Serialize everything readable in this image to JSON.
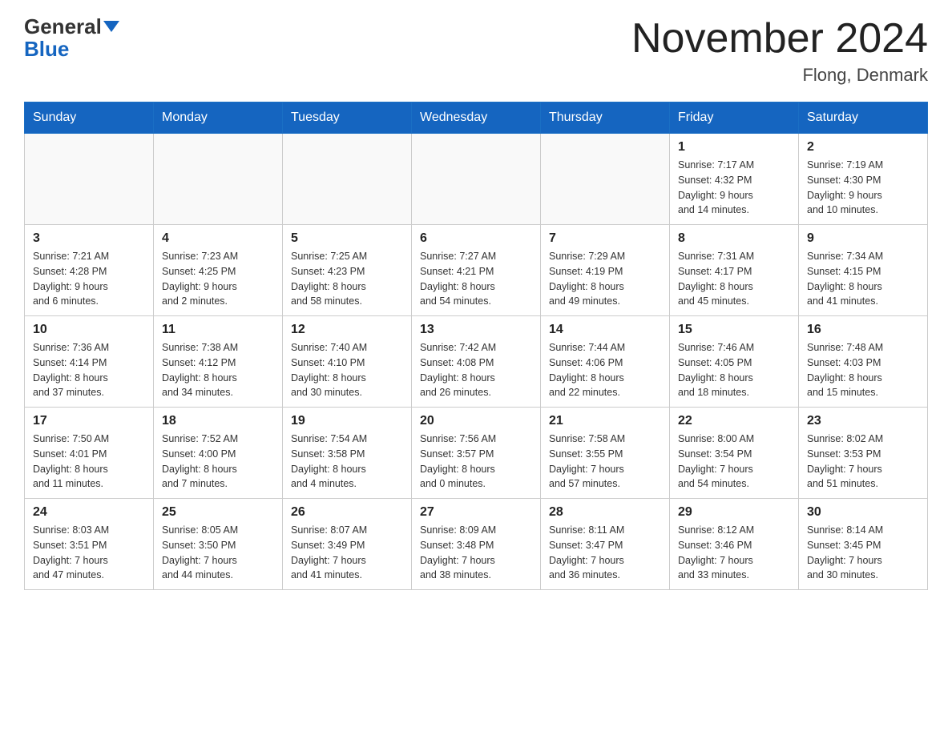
{
  "header": {
    "logo_main": "General",
    "logo_sub": "Blue",
    "title": "November 2024",
    "location": "Flong, Denmark"
  },
  "days_of_week": [
    "Sunday",
    "Monday",
    "Tuesday",
    "Wednesday",
    "Thursday",
    "Friday",
    "Saturday"
  ],
  "weeks": [
    [
      {
        "day": "",
        "info": ""
      },
      {
        "day": "",
        "info": ""
      },
      {
        "day": "",
        "info": ""
      },
      {
        "day": "",
        "info": ""
      },
      {
        "day": "",
        "info": ""
      },
      {
        "day": "1",
        "info": "Sunrise: 7:17 AM\nSunset: 4:32 PM\nDaylight: 9 hours\nand 14 minutes."
      },
      {
        "day": "2",
        "info": "Sunrise: 7:19 AM\nSunset: 4:30 PM\nDaylight: 9 hours\nand 10 minutes."
      }
    ],
    [
      {
        "day": "3",
        "info": "Sunrise: 7:21 AM\nSunset: 4:28 PM\nDaylight: 9 hours\nand 6 minutes."
      },
      {
        "day": "4",
        "info": "Sunrise: 7:23 AM\nSunset: 4:25 PM\nDaylight: 9 hours\nand 2 minutes."
      },
      {
        "day": "5",
        "info": "Sunrise: 7:25 AM\nSunset: 4:23 PM\nDaylight: 8 hours\nand 58 minutes."
      },
      {
        "day": "6",
        "info": "Sunrise: 7:27 AM\nSunset: 4:21 PM\nDaylight: 8 hours\nand 54 minutes."
      },
      {
        "day": "7",
        "info": "Sunrise: 7:29 AM\nSunset: 4:19 PM\nDaylight: 8 hours\nand 49 minutes."
      },
      {
        "day": "8",
        "info": "Sunrise: 7:31 AM\nSunset: 4:17 PM\nDaylight: 8 hours\nand 45 minutes."
      },
      {
        "day": "9",
        "info": "Sunrise: 7:34 AM\nSunset: 4:15 PM\nDaylight: 8 hours\nand 41 minutes."
      }
    ],
    [
      {
        "day": "10",
        "info": "Sunrise: 7:36 AM\nSunset: 4:14 PM\nDaylight: 8 hours\nand 37 minutes."
      },
      {
        "day": "11",
        "info": "Sunrise: 7:38 AM\nSunset: 4:12 PM\nDaylight: 8 hours\nand 34 minutes."
      },
      {
        "day": "12",
        "info": "Sunrise: 7:40 AM\nSunset: 4:10 PM\nDaylight: 8 hours\nand 30 minutes."
      },
      {
        "day": "13",
        "info": "Sunrise: 7:42 AM\nSunset: 4:08 PM\nDaylight: 8 hours\nand 26 minutes."
      },
      {
        "day": "14",
        "info": "Sunrise: 7:44 AM\nSunset: 4:06 PM\nDaylight: 8 hours\nand 22 minutes."
      },
      {
        "day": "15",
        "info": "Sunrise: 7:46 AM\nSunset: 4:05 PM\nDaylight: 8 hours\nand 18 minutes."
      },
      {
        "day": "16",
        "info": "Sunrise: 7:48 AM\nSunset: 4:03 PM\nDaylight: 8 hours\nand 15 minutes."
      }
    ],
    [
      {
        "day": "17",
        "info": "Sunrise: 7:50 AM\nSunset: 4:01 PM\nDaylight: 8 hours\nand 11 minutes."
      },
      {
        "day": "18",
        "info": "Sunrise: 7:52 AM\nSunset: 4:00 PM\nDaylight: 8 hours\nand 7 minutes."
      },
      {
        "day": "19",
        "info": "Sunrise: 7:54 AM\nSunset: 3:58 PM\nDaylight: 8 hours\nand 4 minutes."
      },
      {
        "day": "20",
        "info": "Sunrise: 7:56 AM\nSunset: 3:57 PM\nDaylight: 8 hours\nand 0 minutes."
      },
      {
        "day": "21",
        "info": "Sunrise: 7:58 AM\nSunset: 3:55 PM\nDaylight: 7 hours\nand 57 minutes."
      },
      {
        "day": "22",
        "info": "Sunrise: 8:00 AM\nSunset: 3:54 PM\nDaylight: 7 hours\nand 54 minutes."
      },
      {
        "day": "23",
        "info": "Sunrise: 8:02 AM\nSunset: 3:53 PM\nDaylight: 7 hours\nand 51 minutes."
      }
    ],
    [
      {
        "day": "24",
        "info": "Sunrise: 8:03 AM\nSunset: 3:51 PM\nDaylight: 7 hours\nand 47 minutes."
      },
      {
        "day": "25",
        "info": "Sunrise: 8:05 AM\nSunset: 3:50 PM\nDaylight: 7 hours\nand 44 minutes."
      },
      {
        "day": "26",
        "info": "Sunrise: 8:07 AM\nSunset: 3:49 PM\nDaylight: 7 hours\nand 41 minutes."
      },
      {
        "day": "27",
        "info": "Sunrise: 8:09 AM\nSunset: 3:48 PM\nDaylight: 7 hours\nand 38 minutes."
      },
      {
        "day": "28",
        "info": "Sunrise: 8:11 AM\nSunset: 3:47 PM\nDaylight: 7 hours\nand 36 minutes."
      },
      {
        "day": "29",
        "info": "Sunrise: 8:12 AM\nSunset: 3:46 PM\nDaylight: 7 hours\nand 33 minutes."
      },
      {
        "day": "30",
        "info": "Sunrise: 8:14 AM\nSunset: 3:45 PM\nDaylight: 7 hours\nand 30 minutes."
      }
    ]
  ]
}
